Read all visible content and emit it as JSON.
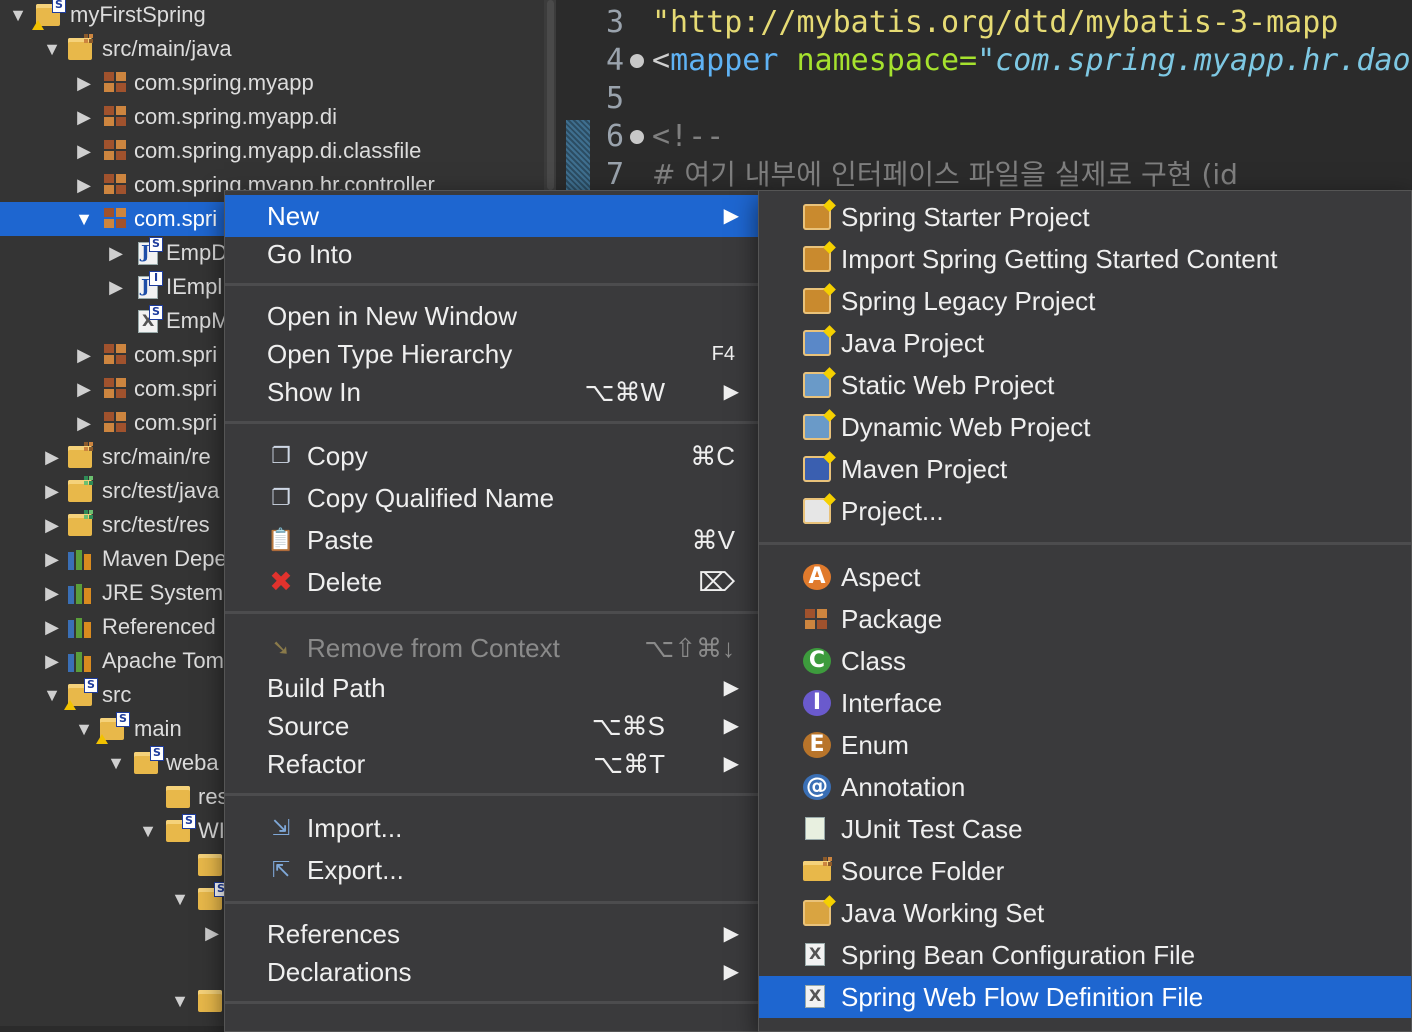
{
  "colors": {
    "selection": "#1e66d0",
    "menu_bg": "#3a3a3c",
    "explorer_bg": "#343434",
    "editor_bg": "#2b2b2b"
  },
  "explorer": {
    "rows": [
      {
        "label": "myFirstSpring",
        "twisty": "▼",
        "icon": "project-icon"
      },
      {
        "label": "src/main/java",
        "twisty": "▼",
        "icon": "source-folder-icon"
      },
      {
        "label": "com.spring.myapp",
        "twisty": "▶",
        "icon": "package-icon"
      },
      {
        "label": "com.spring.myapp.di",
        "twisty": "▶",
        "icon": "package-icon"
      },
      {
        "label": "com.spring.myapp.di.classfile",
        "twisty": "▶",
        "icon": "package-icon"
      },
      {
        "label": "com.spring.myapp.hr.controller",
        "twisty": "▶",
        "icon": "package-icon"
      },
      {
        "label": "com.spri",
        "twisty": "▼",
        "icon": "package-icon",
        "selected": true
      },
      {
        "label": "EmpD",
        "twisty": "▶",
        "icon": "java-file-icon"
      },
      {
        "label": "IEmpl",
        "twisty": "▶",
        "icon": "java-interface-icon"
      },
      {
        "label": "EmpM",
        "twisty": "",
        "icon": "xml-file-icon"
      },
      {
        "label": "com.spri",
        "twisty": "▶",
        "icon": "package-icon"
      },
      {
        "label": "com.spri",
        "twisty": "▶",
        "icon": "package-icon"
      },
      {
        "label": "com.spri",
        "twisty": "▶",
        "icon": "package-icon"
      },
      {
        "label": "src/main/re",
        "twisty": "▶",
        "icon": "source-folder-icon"
      },
      {
        "label": "src/test/java",
        "twisty": "▶",
        "icon": "test-source-folder-icon"
      },
      {
        "label": "src/test/res",
        "twisty": "▶",
        "icon": "test-source-folder-icon"
      },
      {
        "label": "Maven Depe",
        "twisty": "▶",
        "icon": "library-icon"
      },
      {
        "label": "JRE System",
        "twisty": "▶",
        "icon": "library-icon"
      },
      {
        "label": "Referenced",
        "twisty": "▶",
        "icon": "library-icon"
      },
      {
        "label": "Apache Tom",
        "twisty": "▶",
        "icon": "library-icon"
      },
      {
        "label": "src",
        "twisty": "▼",
        "icon": "folder-icon"
      },
      {
        "label": "main",
        "twisty": "▼",
        "icon": "folder-icon"
      },
      {
        "label": "weba",
        "twisty": "▼",
        "icon": "folder-icon"
      },
      {
        "label": "res",
        "twisty": "",
        "icon": "folder-icon"
      },
      {
        "label": "WI",
        "twisty": "▼",
        "icon": "folder-icon"
      },
      {
        "label": "",
        "twisty": "",
        "icon": "folder-icon"
      },
      {
        "label": "",
        "twisty": "▼",
        "icon": "folder-icon"
      },
      {
        "label": "",
        "twisty": "▶",
        "icon": ""
      },
      {
        "label": "",
        "twisty": "",
        "icon": ""
      },
      {
        "label": "",
        "twisty": "▼",
        "icon": "folder-icon"
      }
    ]
  },
  "editor": {
    "lines": [
      {
        "num": "3",
        "code": "    \"http://mybatis.org/dtd/mybatis-3-mapp"
      },
      {
        "num": "4",
        "code_tag_open": "<",
        "code_tag": "mapper",
        "code_attr": " namespace=",
        "code_val": "\"com.spring.myapp.hr.dao"
      },
      {
        "num": "5",
        "code": ""
      },
      {
        "num": "6",
        "code": "<!--"
      },
      {
        "num": "7",
        "code": "    # 여기 내부에 인터페이스 파일을 실제로 구현 (id"
      }
    ]
  },
  "context_menu": {
    "items": [
      {
        "label": "New",
        "arrow": "▶",
        "highlighted": true
      },
      {
        "label": "Go Into"
      },
      {
        "label": "Open in New Window"
      },
      {
        "label": "Open Type Hierarchy",
        "shortcut": "F4"
      },
      {
        "label": "Show In",
        "shortcut": "⌥⌘W",
        "arrow": "▶"
      },
      {
        "label": "Copy",
        "shortcut": "⌘C",
        "icon": "copy-icon"
      },
      {
        "label": "Copy Qualified Name",
        "icon": "copy-qualified-name-icon"
      },
      {
        "label": "Paste",
        "shortcut": "⌘V",
        "icon": "paste-icon"
      },
      {
        "label": "Delete",
        "shortcut": "⌦",
        "icon": "delete-icon"
      },
      {
        "label": "Remove from Context",
        "shortcut": "⌥⇧⌘↓",
        "icon": "remove-context-icon",
        "disabled": true
      },
      {
        "label": "Build Path",
        "arrow": "▶"
      },
      {
        "label": "Source",
        "shortcut": "⌥⌘S",
        "arrow": "▶"
      },
      {
        "label": "Refactor",
        "shortcut": "⌥⌘T",
        "arrow": "▶"
      },
      {
        "label": "Import...",
        "icon": "import-icon"
      },
      {
        "label": "Export...",
        "icon": "export-icon"
      },
      {
        "label": "References",
        "arrow": "▶"
      },
      {
        "label": "Declarations",
        "arrow": "▶"
      }
    ]
  },
  "new_submenu": {
    "items": [
      {
        "label": "Spring Starter Project",
        "icon": "spring-starter-project-icon"
      },
      {
        "label": "Import Spring Getting Started Content",
        "icon": "import-spring-content-icon"
      },
      {
        "label": "Spring Legacy Project",
        "icon": "spring-legacy-project-icon"
      },
      {
        "label": "Java Project",
        "icon": "java-project-icon"
      },
      {
        "label": "Static Web Project",
        "icon": "static-web-project-icon"
      },
      {
        "label": "Dynamic Web Project",
        "icon": "dynamic-web-project-icon"
      },
      {
        "label": "Maven Project",
        "icon": "maven-project-icon"
      },
      {
        "label": "Project...",
        "icon": "project-wizard-icon"
      },
      {
        "label": "Aspect",
        "icon": "aspect-icon",
        "glyph": "A"
      },
      {
        "label": "Package",
        "icon": "package-wizard-icon"
      },
      {
        "label": "Class",
        "icon": "class-icon",
        "glyph": "C"
      },
      {
        "label": "Interface",
        "icon": "interface-icon",
        "glyph": "I"
      },
      {
        "label": "Enum",
        "icon": "enum-icon",
        "glyph": "E"
      },
      {
        "label": "Annotation",
        "icon": "annotation-icon",
        "glyph": "@"
      },
      {
        "label": "JUnit Test Case",
        "icon": "junit-test-case-icon"
      },
      {
        "label": "Source Folder",
        "icon": "source-folder-wizard-icon"
      },
      {
        "label": "Java Working Set",
        "icon": "java-working-set-icon"
      },
      {
        "label": "Spring Bean Configuration File",
        "icon": "spring-bean-config-icon"
      },
      {
        "label": "Spring Web Flow Definition File",
        "icon": "spring-web-flow-icon",
        "highlighted": true
      }
    ]
  }
}
